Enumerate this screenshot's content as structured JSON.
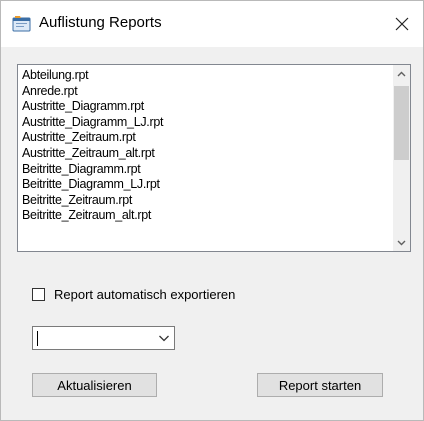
{
  "window": {
    "title": "Auflistung Reports",
    "icon": "report-window-icon",
    "close_glyph": "✕"
  },
  "report_list": {
    "items": [
      "Abteilung.rpt",
      "Anrede.rpt",
      "Austritte_Diagramm.rpt",
      "Austritte_Diagramm_LJ.rpt",
      "Austritte_Zeitraum.rpt",
      "Austritte_Zeitraum_alt.rpt",
      "Beitritte_Diagramm.rpt",
      "Beitritte_Diagramm_LJ.rpt",
      "Beitritte_Zeitraum.rpt",
      "Beitritte_Zeitraum_alt.rpt"
    ]
  },
  "auto_export": {
    "label": "Report automatisch exportieren",
    "checked": false
  },
  "export_format": {
    "value": ""
  },
  "buttons": {
    "refresh": "Aktualisieren",
    "start": "Report starten"
  },
  "colors": {
    "window_bg": "#f0f0f0",
    "button_bg": "#e1e1e1",
    "scroll_thumb": "#cdcdcd"
  }
}
